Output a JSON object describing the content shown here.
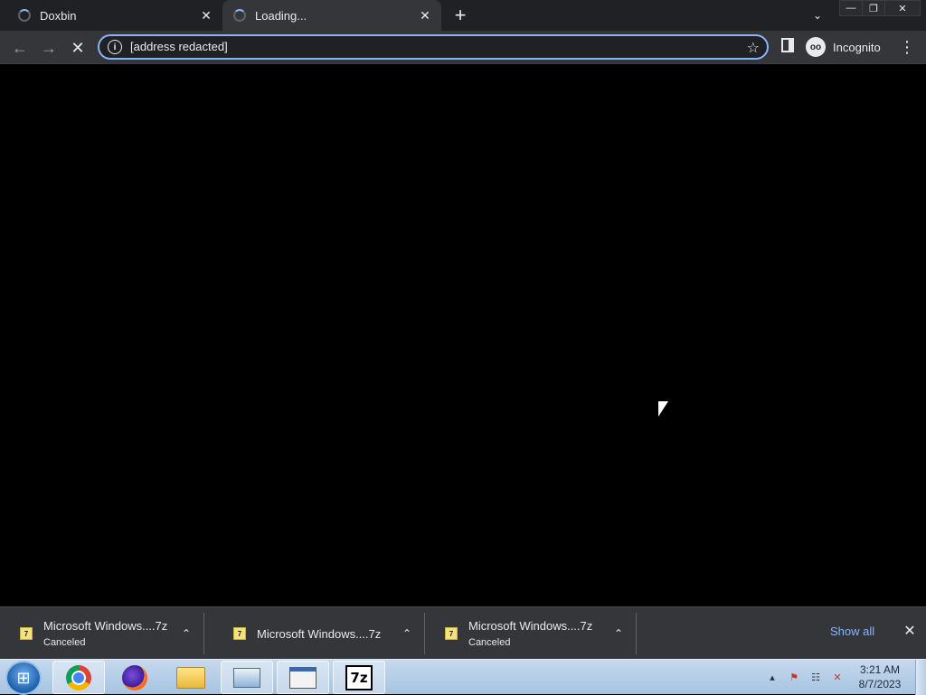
{
  "tabs": [
    {
      "title": "Doxbin",
      "close": "✕"
    },
    {
      "title": "Loading...",
      "close": "✕"
    }
  ],
  "new_tab_symbol": "+",
  "tab_search_symbol": "⌄",
  "window_controls": {
    "minimize": "—",
    "restore": "❐",
    "close": "✕"
  },
  "nav": {
    "back": "←",
    "forward": "→",
    "stop": "✕"
  },
  "omnibox": {
    "url": "[address redacted]",
    "info_symbol": "i",
    "star_symbol": "☆"
  },
  "profile": {
    "label": "Incognito",
    "icon_symbol": "oo"
  },
  "menu_symbol": "⋮",
  "downloads": [
    {
      "name": "Microsoft Windows....7z",
      "status": "Canceled"
    },
    {
      "name": "Microsoft Windows....7z",
      "status": ""
    },
    {
      "name": "Microsoft Windows....7z",
      "status": "Canceled"
    }
  ],
  "download_icon_text": "7",
  "download_chevron": "⌃",
  "show_all": "Show all",
  "shelf_close": "✕",
  "taskbar": {
    "start_symbol": "⊞",
    "apps": [
      "chrome-icon",
      "firefox-icon",
      "file-explorer-icon",
      "computer-icon",
      "window-icon",
      "7zip-icon"
    ],
    "sevenzip_label": "7z"
  },
  "tray": {
    "arrow": "▴",
    "flag": "⚑",
    "network": "☷",
    "volume": "✕"
  },
  "clock": {
    "time": "3:21 AM",
    "date": "8/7/2023"
  },
  "colors": {
    "accent": "#8ab4f8",
    "frame": "#202124",
    "toolbar": "#35363a"
  }
}
